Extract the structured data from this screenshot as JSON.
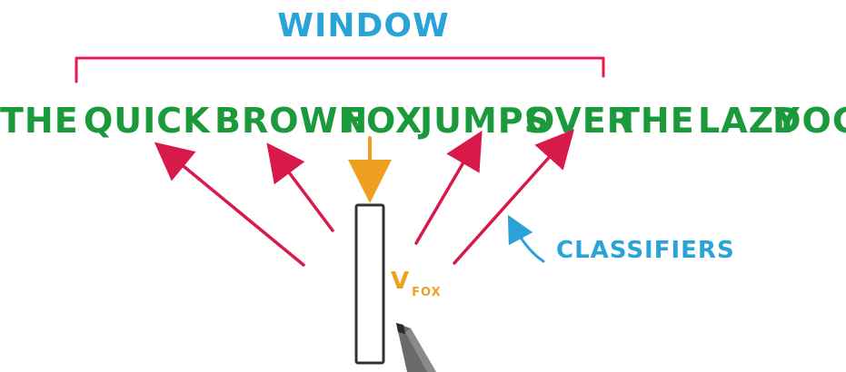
{
  "window_label": "WINDOW",
  "sentence": [
    "THE",
    "QUICK",
    "BROWN",
    "FOX",
    "JUMPS",
    "OVER",
    "THE",
    "LAZY",
    "DOG"
  ],
  "vector_label": {
    "main": "V",
    "subscript": "FOX"
  },
  "classifiers_label": "CLASSIFIERS",
  "colors": {
    "window": "#e8184f",
    "label_blue": "#2aa3d8",
    "words_green": "#1a9a3a",
    "arrow_red": "#d81a4a",
    "arrow_orange": "#f0a020",
    "vector_box": "#333333",
    "pen": "#444444"
  },
  "icons": [
    "pen-icon"
  ]
}
